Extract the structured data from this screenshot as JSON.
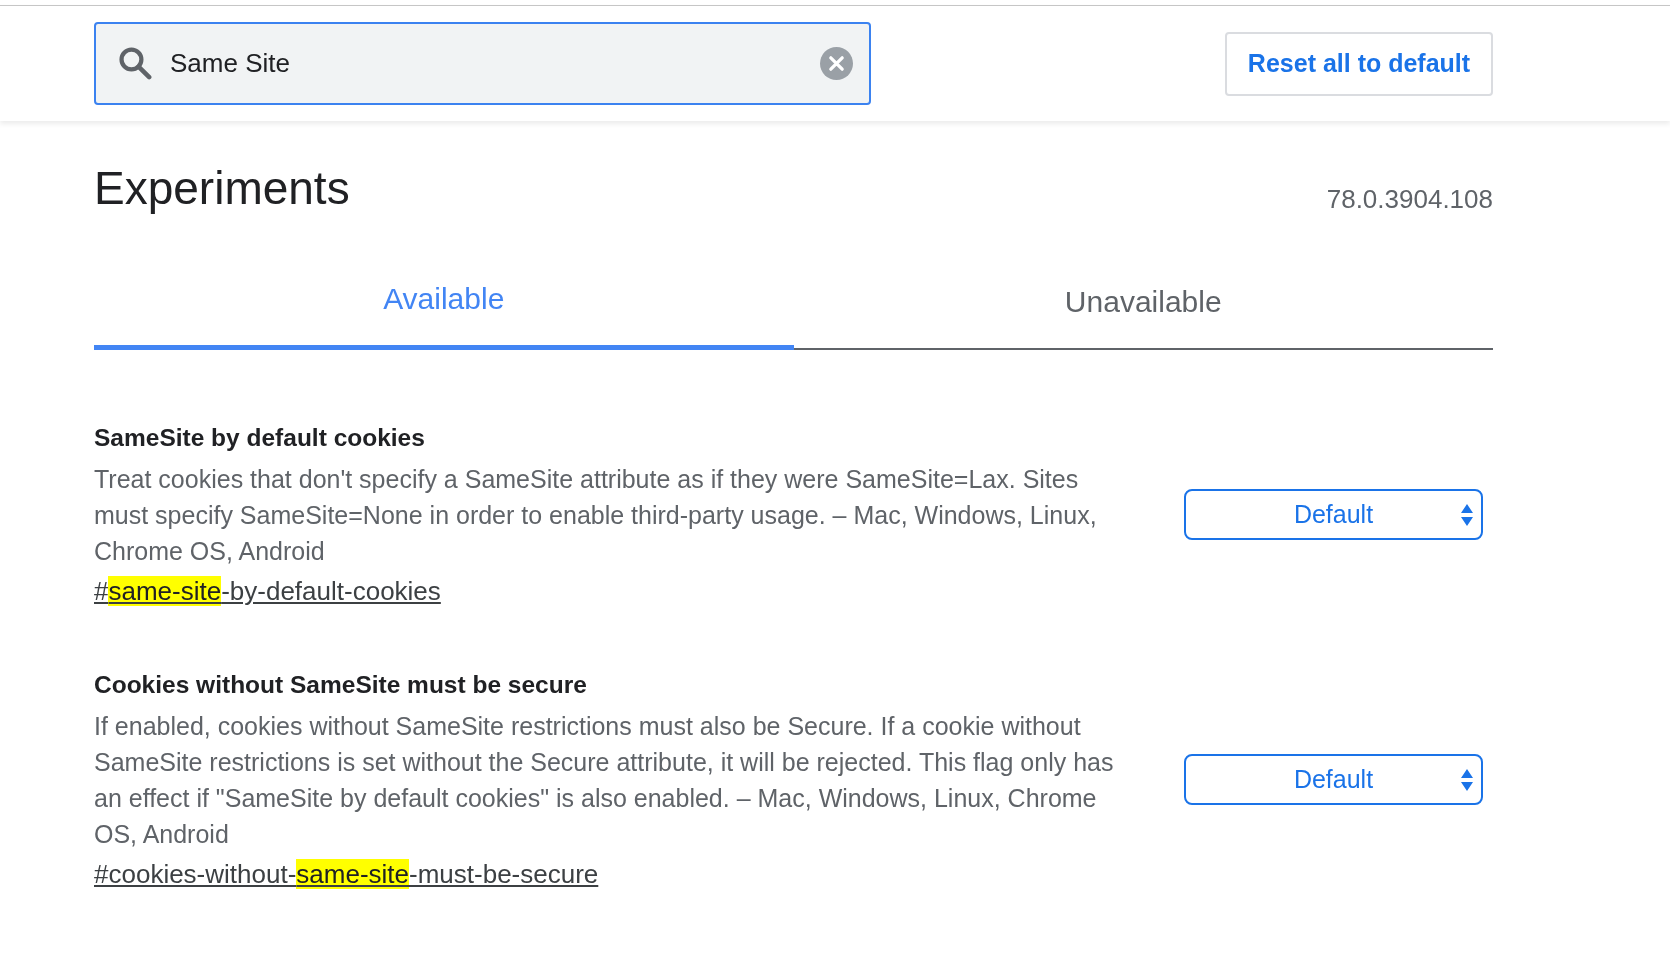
{
  "search": {
    "value": "Same Site"
  },
  "reset_button": {
    "label": "Reset all to default"
  },
  "page": {
    "title": "Experiments",
    "version": "78.0.3904.108"
  },
  "tabs": [
    {
      "label": "Available",
      "selected": true
    },
    {
      "label": "Unavailable",
      "selected": false
    }
  ],
  "experiments": [
    {
      "name": "SameSite by default cookies",
      "description": "Treat cookies that don't specify a SameSite attribute as if they were SameSite=Lax. Sites must specify SameSite=None in order to enable third-party usage. – Mac, Windows, Linux, Chrome OS, Android",
      "link": [
        {
          "text": "#",
          "highlighted": false
        },
        {
          "text": "same-site",
          "highlighted": true
        },
        {
          "text": "-by-default-cookies",
          "highlighted": false
        }
      ],
      "select": {
        "value": "Default"
      }
    },
    {
      "name": "Cookies without SameSite must be secure",
      "description": "If enabled, cookies without SameSite restrictions must also be Secure. If a cookie without SameSite restrictions is set without the Secure attribute, it will be rejected. This flag only has an effect if \"SameSite by default cookies\" is also enabled. – Mac, Windows, Linux, Chrome OS, Android",
      "link": [
        {
          "text": "#cookies-without-",
          "highlighted": false
        },
        {
          "text": "same-site",
          "highlighted": true
        },
        {
          "text": "-must-be-secure",
          "highlighted": false
        }
      ],
      "select": {
        "value": "Default"
      }
    }
  ]
}
